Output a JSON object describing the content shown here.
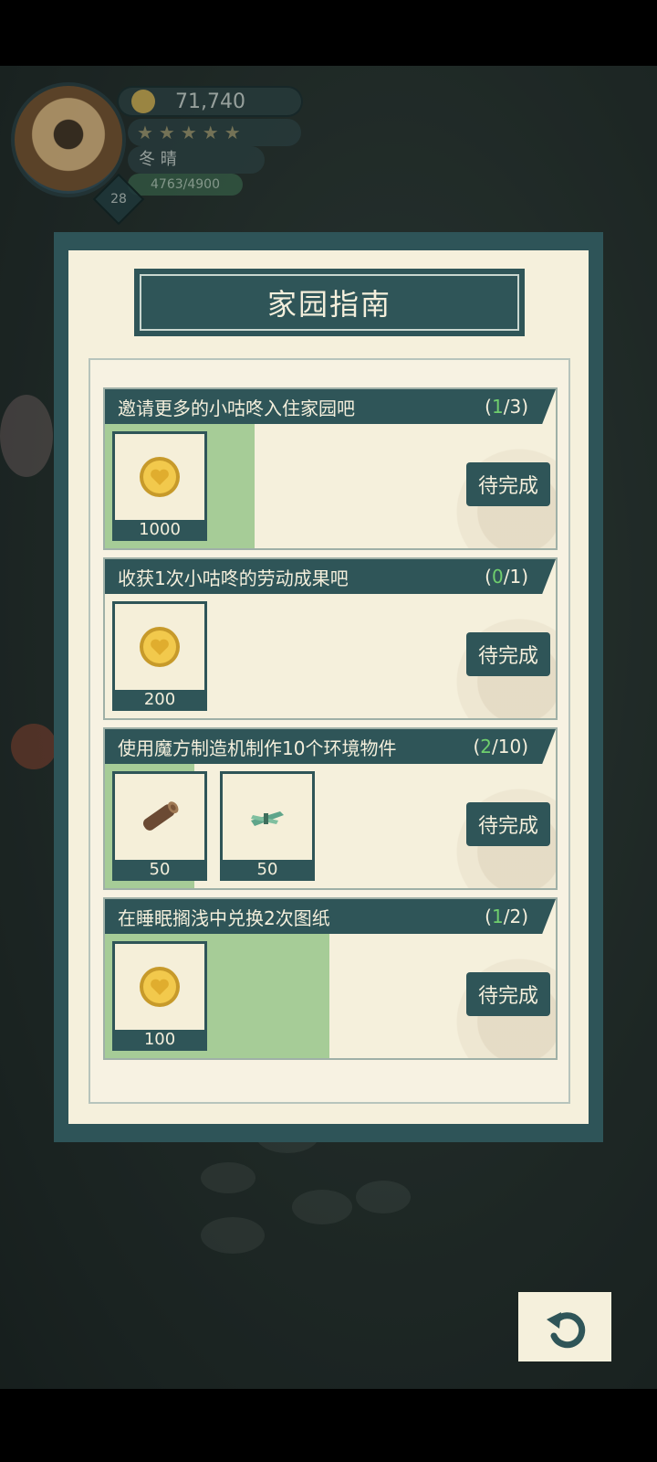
{
  "hud": {
    "coins": "71,740",
    "stars": "★★★★★",
    "weather": "冬  晴",
    "xp": "4763/4900",
    "level": "28"
  },
  "dialog": {
    "title": "家园指南",
    "tasks": [
      {
        "name": "邀请更多的小咕咚入住家园吧",
        "done": "1",
        "total": "3",
        "progress_fraction": 0.333,
        "rewards": [
          {
            "icon": "gold-coin-icon",
            "qty": "1000"
          }
        ],
        "button": "待完成"
      },
      {
        "name": "收获1次小咕咚的劳动成果吧",
        "done": "0",
        "total": "1",
        "progress_fraction": 0,
        "rewards": [
          {
            "icon": "gold-coin-icon",
            "qty": "200"
          }
        ],
        "button": "待完成"
      },
      {
        "name": "使用魔方制造机制作10个环境物件",
        "done": "2",
        "total": "10",
        "progress_fraction": 0.2,
        "rewards": [
          {
            "icon": "wood-log-icon",
            "qty": "50"
          },
          {
            "icon": "grass-bundle-icon",
            "qty": "50"
          }
        ],
        "button": "待完成"
      },
      {
        "name": "在睡眠搁浅中兑换2次图纸",
        "done": "1",
        "total": "2",
        "progress_fraction": 0.5,
        "rewards": [
          {
            "icon": "gold-coin-icon",
            "qty": "100"
          }
        ],
        "button": "待完成"
      }
    ]
  },
  "colors": {
    "panel_dark": "#2f5558",
    "panel_light": "#f5f0dc",
    "progress_green": "#a6cc97",
    "done_count_green": "#6fce6d"
  }
}
